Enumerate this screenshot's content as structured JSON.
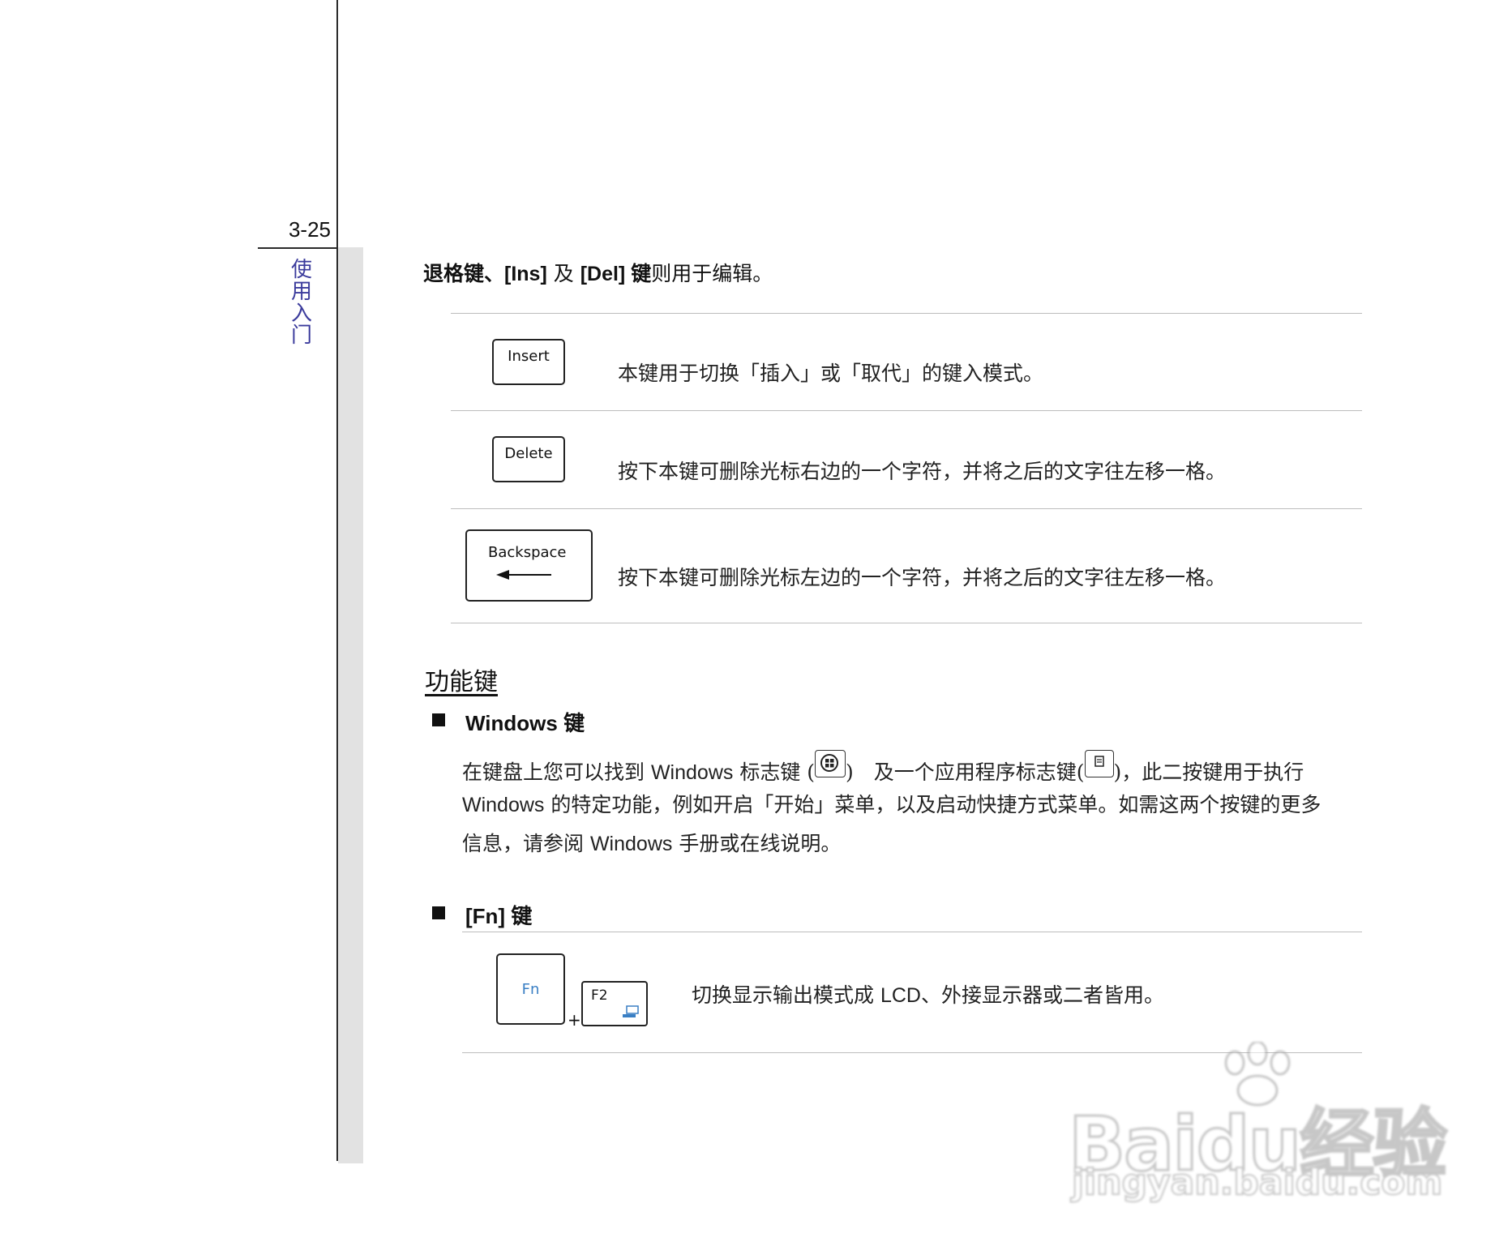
{
  "page": {
    "number": "3-25",
    "chapter": "使用入门"
  },
  "intro": {
    "p1": "退格键、",
    "k1": "[Ins]",
    "p2": " 及 ",
    "k2": "[Del]",
    "p3": " 键",
    "p4": "则用于编辑。"
  },
  "edit_keys": [
    {
      "key": "Insert",
      "desc": "本键用于切换「插入」或「取代」的键入模式。"
    },
    {
      "key": "Delete",
      "desc": "按下本键可删除光标右边的一个字符，并将之后的文字往左移一格。"
    },
    {
      "key": "Backspace",
      "desc": "按下本键可删除光标左边的一个字符，并将之后的文字往左移一格。"
    }
  ],
  "function_keys": {
    "title": "功能键",
    "windows": {
      "title_en": "Windows",
      "title_zh": " 键",
      "line1a": "在键盘上您可以找到 ",
      "line1b": "Windows",
      "line1c": " 标志键 (",
      "line1d": ")　及一个应用程序标志键(",
      "line1e": ")，此二按键用于执行",
      "line2a": "Windows",
      "line2b": " 的特定功能，例如开启「开始」菜单，以及启动快捷方式菜单。如需这两个按键的更多",
      "line3a": "信息，请参阅 ",
      "line3b": "Windows",
      "line3c": " 手册或在线说明。"
    },
    "fn": {
      "title_en": "[Fn]",
      "title_zh": " 键",
      "key1": "Fn",
      "plus": "+",
      "key2": "F2",
      "desc_a": "切换显示输出模式成 ",
      "desc_b": "LCD",
      "desc_c": "、外接显示器或二者皆用。"
    }
  },
  "watermark": {
    "main": "Baidu经验",
    "sub": "jingyan.baidu.com"
  },
  "colors": {
    "chapter": "#3b3b9c",
    "fn_key": "#3a7fc4",
    "rule": "#bdbdbd",
    "band": "#e2e2e2"
  }
}
